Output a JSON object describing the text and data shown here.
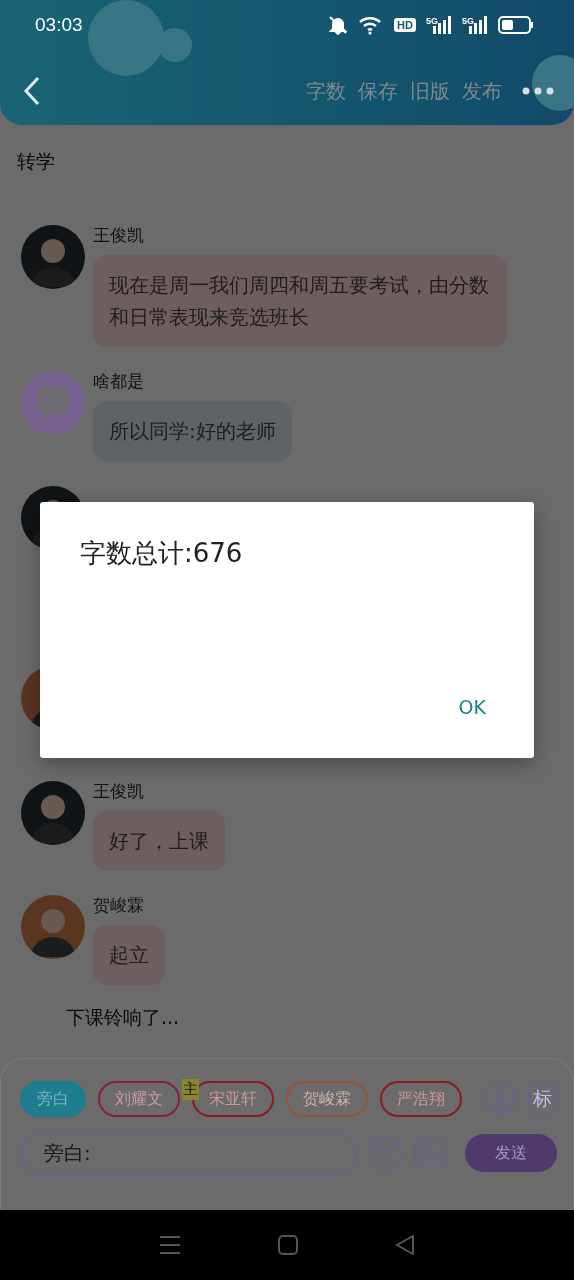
{
  "status_bar": {
    "time": "03:03",
    "hd": "HD",
    "networks": [
      "5G",
      "5G"
    ]
  },
  "header": {
    "actions": [
      "字数",
      "保存",
      "旧版",
      "发布"
    ]
  },
  "chat": [
    {
      "kind": "narration",
      "text": "转学"
    },
    {
      "kind": "message",
      "sender": "王俊凯",
      "text": "现在是周一我们周四和周五要考试，由分数和日常表现来竞选班长",
      "color": "#6e5e5f",
      "avatar": {
        "kind": "photo",
        "color": "#101416"
      }
    },
    {
      "kind": "message",
      "sender": "啥都是",
      "text": "所以同学:好的老师",
      "color": "#5f6366",
      "avatar": {
        "kind": "icon",
        "color": "#76608e"
      }
    },
    {
      "kind": "covered",
      "avatars": [
        {
          "kind": "photo",
          "color": "#101416"
        },
        {
          "kind": "photo",
          "color": "#5a3520"
        }
      ]
    },
    {
      "kind": "message",
      "sender": "王俊凯",
      "text": "好了，上课",
      "color": "#6e5e5f",
      "avatar": {
        "kind": "photo",
        "color": "#101416"
      }
    },
    {
      "kind": "message",
      "sender": "贺峻霖",
      "text": "起立",
      "color": "#6e5e5f",
      "avatar": {
        "kind": "photo",
        "color": "#5a3520"
      }
    },
    {
      "kind": "narration_indent",
      "text": "下课铃响了..."
    }
  ],
  "roles": [
    {
      "label": "旁白",
      "selected": true,
      "color": "#1d7c8e"
    },
    {
      "label": "刘耀文",
      "selected": false,
      "color": "#8a1e40"
    },
    {
      "label": "宋亚轩",
      "selected": false,
      "color": "#8c1a25",
      "badge": "主"
    },
    {
      "label": "贺峻霖",
      "selected": false,
      "color": "#965437"
    },
    {
      "label": "严浩翔",
      "selected": false,
      "color": "#8c1a1e"
    }
  ],
  "mark_button": "标",
  "input": {
    "placeholder": "旁白:"
  },
  "send_button": "发送",
  "dialog": {
    "message": "字数总计:676",
    "button": "OK"
  }
}
